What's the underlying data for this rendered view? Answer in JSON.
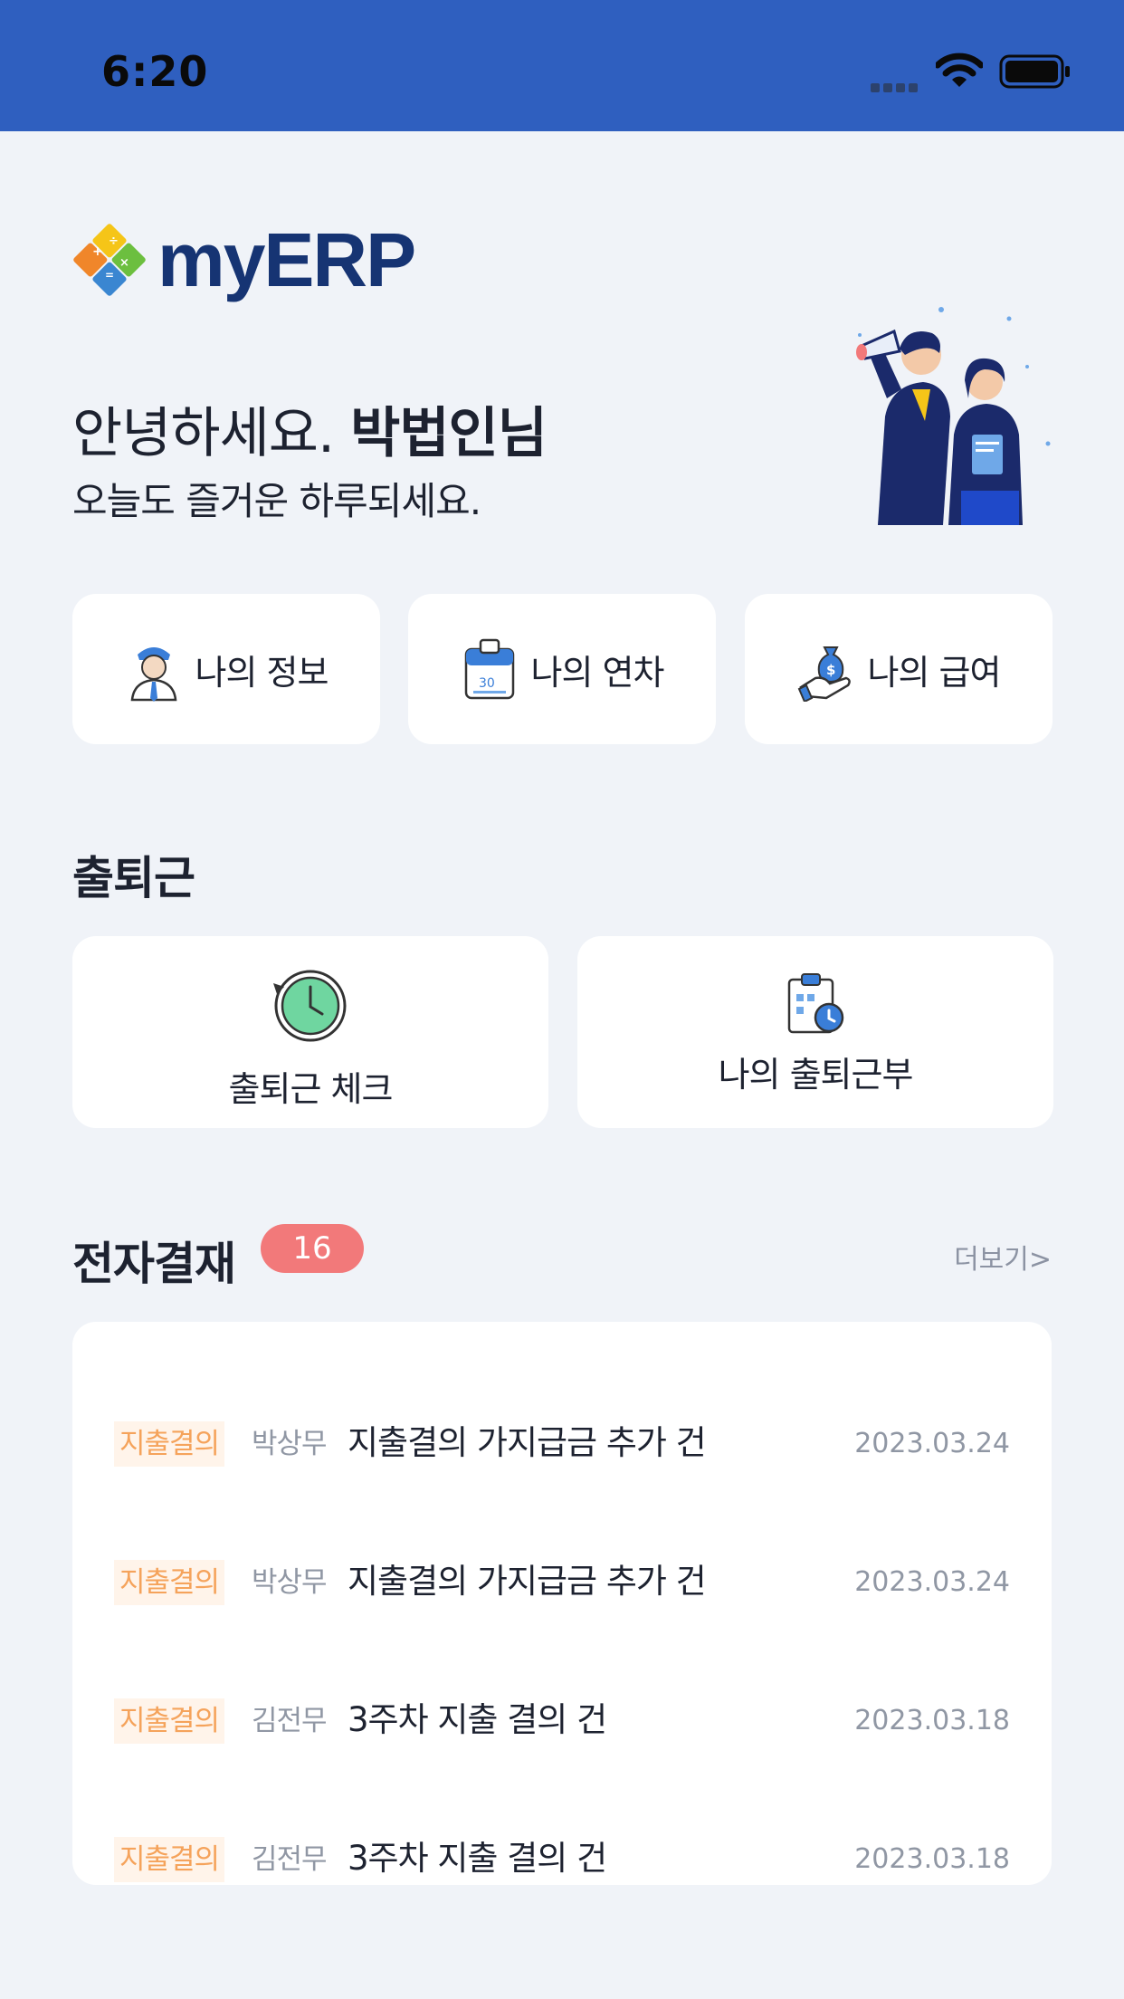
{
  "status_bar": {
    "time": "6:20"
  },
  "app": {
    "logo_text": "myERP"
  },
  "greeting": {
    "hello": "안녕하세요.",
    "user_name": "박법인님",
    "subtitle": "오늘도 즐거운 하루되세요."
  },
  "quick_menu": [
    {
      "label": "나의 정보",
      "icon": "person-icon"
    },
    {
      "label": "나의 연차",
      "icon": "calendar-icon"
    },
    {
      "label": "나의 급여",
      "icon": "salary-icon"
    }
  ],
  "attendance": {
    "title": "출퇴근",
    "check_label": "출퇴근 체크",
    "records_label": "나의 출퇴근부"
  },
  "approval": {
    "title": "전자결재",
    "count": "16",
    "more_label": "더보기>",
    "items": [
      {
        "category": "지출결의",
        "author": "박상무",
        "subject": "지출결의 가지급금 추가 건",
        "date": "2023.03.24"
      },
      {
        "category": "지출결의",
        "author": "박상무",
        "subject": "지출결의 가지급금 추가 건",
        "date": "2023.03.24"
      },
      {
        "category": "지출결의",
        "author": "김전무",
        "subject": "3주차 지출 결의 건",
        "date": "2023.03.18"
      },
      {
        "category": "지출결의",
        "author": "김전무",
        "subject": "3주차 지출 결의 건",
        "date": "2023.03.18"
      }
    ]
  },
  "colors": {
    "status_bar": "#2f5fbf",
    "background": "#f0f3f8",
    "badge": "#f2797a",
    "category_text": "#f5a35b",
    "logo_text": "#163473"
  }
}
